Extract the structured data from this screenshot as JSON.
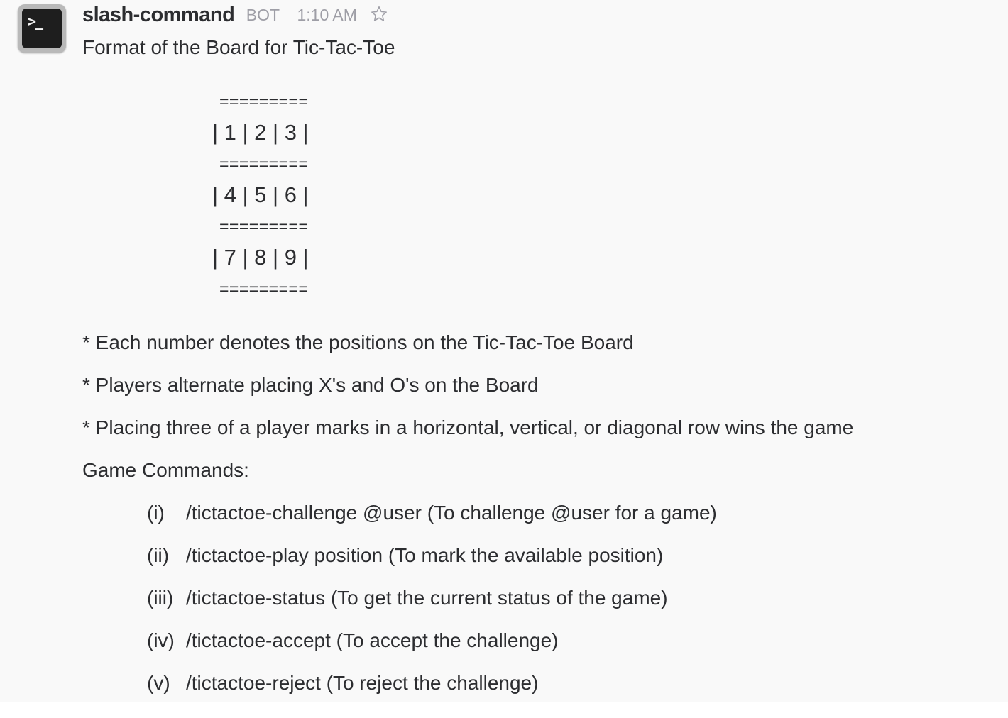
{
  "message": {
    "sender": "slash-command",
    "badge": "BOT",
    "time": "1:10 AM",
    "avatar_icon": "terminal-icon",
    "star_icon": "star-outline-icon",
    "title": "Format of the Board for Tic-Tac-Toe",
    "board": {
      "separator": "=========",
      "rows": [
        "| 1 | 2 | 3 |",
        "| 4 | 5 | 6 |",
        "| 7 | 8 | 9 |"
      ]
    },
    "notes": [
      "* Each number denotes the positions on the Tic-Tac-Toe Board",
      "* Players alternate placing X's and O's on the Board",
      "* Placing three of a player marks in a horizontal, vertical, or diagonal row wins the game"
    ],
    "commands_heading": "Game Commands:",
    "commands": [
      {
        "num": "(i)",
        "text": "/tictactoe-challenge @user (To challenge @user for a game)"
      },
      {
        "num": "(ii)",
        "text": "/tictactoe-play position (To mark the available position)"
      },
      {
        "num": "(iii)",
        "text": "/tictactoe-status (To get the current status of the game)"
      },
      {
        "num": "(iv)",
        "text": "/tictactoe-accept (To accept the challenge)"
      },
      {
        "num": "(v)",
        "text": "/tictactoe-reject (To reject the challenge)"
      }
    ]
  }
}
